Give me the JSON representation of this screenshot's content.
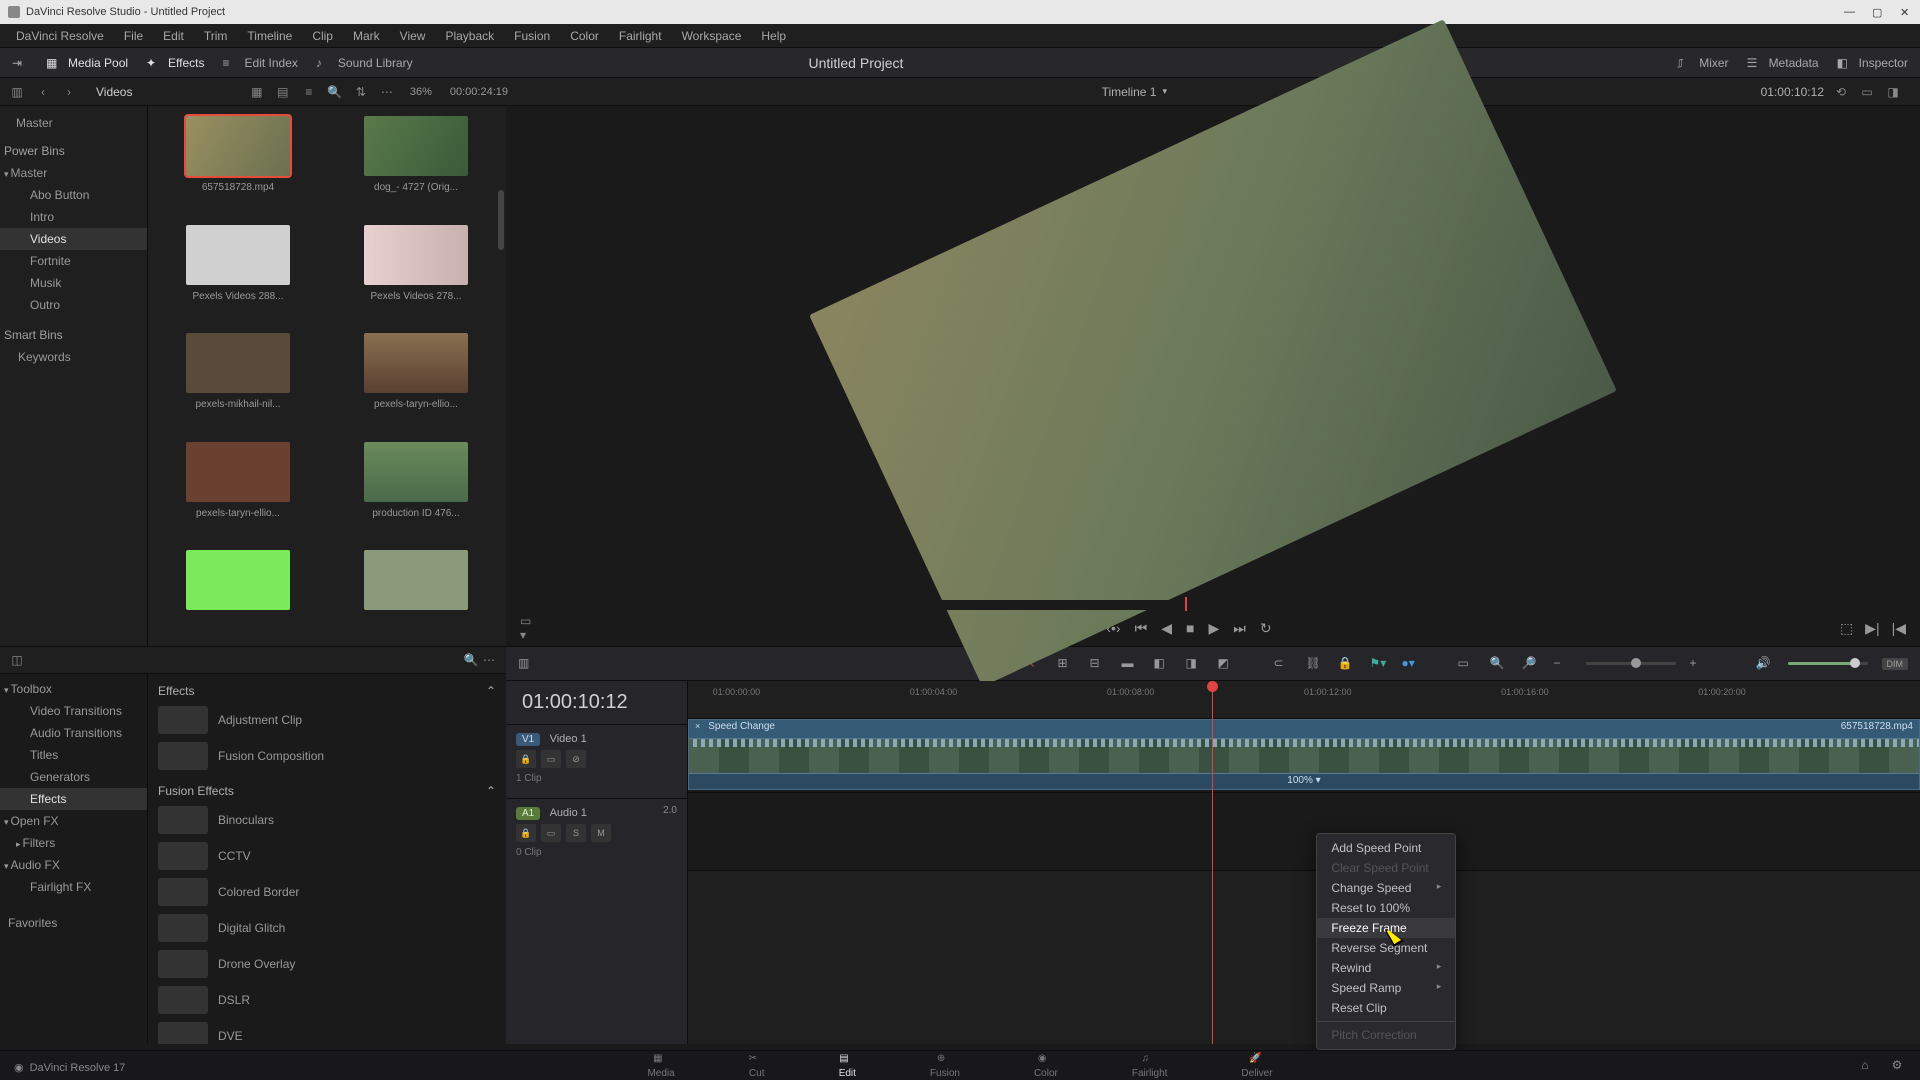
{
  "titlebar": {
    "text": "DaVinci Resolve Studio - Untitled Project"
  },
  "menu": [
    "DaVinci Resolve",
    "File",
    "Edit",
    "Trim",
    "Timeline",
    "Clip",
    "Mark",
    "View",
    "Playback",
    "Fusion",
    "Color",
    "Fairlight",
    "Workspace",
    "Help"
  ],
  "toolbar": {
    "media_pool": "Media Pool",
    "effects": "Effects",
    "edit_index": "Edit Index",
    "sound_library": "Sound Library",
    "project": "Untitled Project",
    "mixer": "Mixer",
    "metadata": "Metadata",
    "inspector": "Inspector"
  },
  "subbar": {
    "crumb": "Videos",
    "zoom": "36%",
    "time": "00:00:24:19",
    "timeline_name": "Timeline 1",
    "tc": "01:00:10:12"
  },
  "bins": {
    "master": "Master",
    "power": "Power Bins",
    "power_items": [
      "Master",
      "Abo Button",
      "Intro",
      "Videos",
      "Fortnite",
      "Musik",
      "Outro"
    ],
    "smart": "Smart Bins",
    "smart_items": [
      "Keywords"
    ]
  },
  "clips": [
    {
      "name": "657518728.mp4"
    },
    {
      "name": "dog_- 4727 (Orig..."
    },
    {
      "name": "Pexels Videos 288..."
    },
    {
      "name": "Pexels Videos 278..."
    },
    {
      "name": "pexels-mikhail-nil..."
    },
    {
      "name": "pexels-taryn-ellio..."
    },
    {
      "name": "pexels-taryn-ellio..."
    },
    {
      "name": "production ID 476..."
    }
  ],
  "fx_tree": {
    "toolbox": "Toolbox",
    "items": [
      "Video Transitions",
      "Audio Transitions",
      "Titles",
      "Generators",
      "Effects"
    ],
    "openfx": "Open FX",
    "filters": "Filters",
    "audiofx": "Audio FX",
    "fair": "Fairlight FX",
    "fav": "Favorites"
  },
  "fx_list": {
    "header1": "Effects",
    "items1": [
      "Adjustment Clip",
      "Fusion Composition"
    ],
    "header2": "Fusion Effects",
    "items2": [
      "Binoculars",
      "CCTV",
      "Colored Border",
      "Digital Glitch",
      "Drone Overlay",
      "DSLR",
      "DVE"
    ]
  },
  "timeline": {
    "big_tc": "01:00:10:12",
    "v_label": "V1",
    "v_name": "Video 1",
    "a_label": "A1",
    "a_name": "Audio 1",
    "a_ch": "2.0",
    "clip_title": "Speed Change",
    "clip_file": "657518728.mp4",
    "speed": "100%",
    "v_meta": "1 Clip",
    "a_meta": "0 Clip",
    "ticks": [
      "01:00:00:00",
      "01:00:04:00",
      "01:00:08:00",
      "01:00:12:00",
      "01:00:16:00",
      "01:00:20:00"
    ]
  },
  "ctx": {
    "add": "Add Speed Point",
    "clear": "Clear Speed Point",
    "change": "Change Speed",
    "reset100": "Reset to 100%",
    "freeze": "Freeze Frame",
    "reverse": "Reverse Segment",
    "rewind": "Rewind",
    "ramp": "Speed Ramp",
    "resetclip": "Reset Clip",
    "pitch": "Pitch Correction"
  },
  "pages": [
    "Media",
    "Cut",
    "Edit",
    "Fusion",
    "Color",
    "Fairlight",
    "Deliver"
  ],
  "status": {
    "app": "DaVinci Resolve 17"
  }
}
